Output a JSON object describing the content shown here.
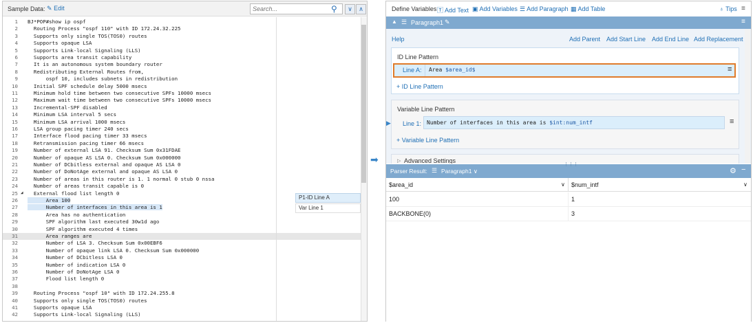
{
  "left_panel": {
    "sample_label": "Sample Data:",
    "edit_label": "Edit",
    "search_placeholder": "Search...",
    "code_lines": [
      [
        "1",
        "BJ*POP#show ip ospf"
      ],
      [
        "2",
        "  Routing Process \"ospf 110\" with ID 172.24.32.225"
      ],
      [
        "3",
        "  Supports only single TOS(TOS0) routes"
      ],
      [
        "4",
        "  Supports opaque LSA"
      ],
      [
        "5",
        "  Supports Link-local Signaling (LLS)"
      ],
      [
        "6",
        "  Supports area transit capability"
      ],
      [
        "7",
        "  It is an autonomous system boundary router"
      ],
      [
        "8",
        "  Redistributing External Routes from,"
      ],
      [
        "9",
        "      ospf 10, includes subnets in redistribution"
      ],
      [
        "10",
        "  Initial SPF schedule delay 5000 msecs"
      ],
      [
        "11",
        "  Minimum hold time between two consecutive SPFs 10000 msecs"
      ],
      [
        "12",
        "  Maximum wait time between two consecutive SPFs 10000 msecs"
      ],
      [
        "13",
        "  Incremental-SPF disabled"
      ],
      [
        "14",
        "  Minimum LSA interval 5 secs"
      ],
      [
        "15",
        "  Minimum LSA arrival 1000 msecs"
      ],
      [
        "16",
        "  LSA group pacing timer 240 secs"
      ],
      [
        "17",
        "  Interface flood pacing timer 33 msecs"
      ],
      [
        "18",
        "  Retransmission pacing timer 66 msecs"
      ],
      [
        "19",
        "  Number of external LSA 91. Checksum Sum 0x31FDAE"
      ],
      [
        "20",
        "  Number of opaque AS LSA 0. Checksum Sum 0x000000"
      ],
      [
        "21",
        "  Number of DCbitless external and opaque AS LSA 0"
      ],
      [
        "22",
        "  Number of DoNotAge external and opaque AS LSA 0"
      ],
      [
        "23",
        "  Number of areas in this router is 1. 1 normal 0 stub 0 nssa"
      ],
      [
        "24",
        "  Number of areas transit capable is 0"
      ],
      [
        "25",
        "  External flood list length 0"
      ],
      [
        "26",
        "      Area 100"
      ],
      [
        "27",
        "      Number of interfaces in this area is 1"
      ],
      [
        "28",
        "      Area has no authentication"
      ],
      [
        "29",
        "      SPF algorithm last executed 30w1d ago"
      ],
      [
        "30",
        "      SPF algorithm executed 4 times"
      ],
      [
        "31",
        "      Area ranges are"
      ],
      [
        "32",
        "      Number of LSA 3. Checksum Sum 0x00EBF6"
      ],
      [
        "33",
        "      Number of opaque link LSA 0. Checksum Sum 0x000000"
      ],
      [
        "34",
        "      Number of DCbitless LSA 0"
      ],
      [
        "35",
        "      Number of indication LSA 0"
      ],
      [
        "36",
        "      Number of DoNotAge LSA 0"
      ],
      [
        "37",
        "      Flood list length 0"
      ],
      [
        "38",
        ""
      ],
      [
        "39",
        "  Routing Process \"ospf 10\" with ID 172.24.255.8"
      ],
      [
        "40",
        "  Supports only single TOS(TOS0) routes"
      ],
      [
        "41",
        "  Supports opaque LSA"
      ],
      [
        "42",
        "  Supports Link-local Signaling (LLS)"
      ]
    ],
    "annotations": [
      "P1-ID Line A",
      "Var Line 1"
    ]
  },
  "toolbar": {
    "define_variables": "Define Variables",
    "add_text": "Add Text",
    "add_variables": "Add Variables",
    "add_paragraph": "Add Paragraph",
    "add_table": "Add Table",
    "tips": "Tips"
  },
  "paragraph": {
    "title": "Paragraph1",
    "help": "Help",
    "add_parent": "Add Parent",
    "add_start_line": "Add Start Line",
    "add_end_line": "Add End Line",
    "add_replacement": "Add Replacement",
    "id_section_title": "ID Line Pattern",
    "id_line_label": "Line A:",
    "id_line_text": "Area ",
    "id_line_var": "$area_id$",
    "add_id_line": "+ ID Line Pattern",
    "var_section_title": "Variable Line Pattern",
    "var_line_label": "Line 1:",
    "var_line_text": "Number of interfaces in this area is ",
    "var_line_var": "$int:num_intf",
    "add_var_line": "+ Variable Line Pattern",
    "advanced": "Advanced Settings"
  },
  "results": {
    "label": "Parser Result:",
    "paragraph": "Paragraph1",
    "columns": [
      "$area_id",
      "$num_intf"
    ],
    "rows": [
      [
        "100",
        "1"
      ],
      [
        "BACKBONE(0)",
        "3"
      ]
    ]
  },
  "colors": {
    "accent": "#7fa9cf",
    "link": "#1f6fb5",
    "highlight_border": "#e07b2a"
  }
}
